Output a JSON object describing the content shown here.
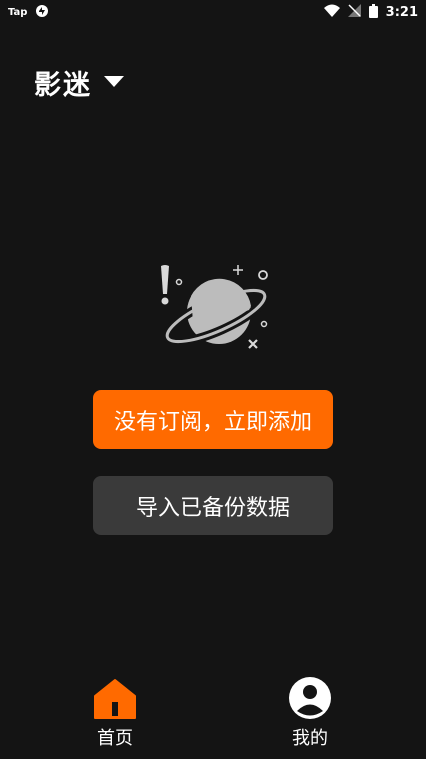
{
  "status_bar": {
    "left_label": "Tap",
    "time": "3:21"
  },
  "header": {
    "title": "影迷"
  },
  "empty_state": {
    "subscribe_button": "没有订阅，立即添加",
    "import_button": "导入已备份数据"
  },
  "bottom_nav": {
    "items": [
      {
        "label": "首页",
        "icon": "home-icon",
        "active": true
      },
      {
        "label": "我的",
        "icon": "profile-icon",
        "active": false
      }
    ]
  },
  "colors": {
    "accent": "#ff6a00",
    "background": "#141414",
    "secondary_button": "#3a3a3a"
  }
}
